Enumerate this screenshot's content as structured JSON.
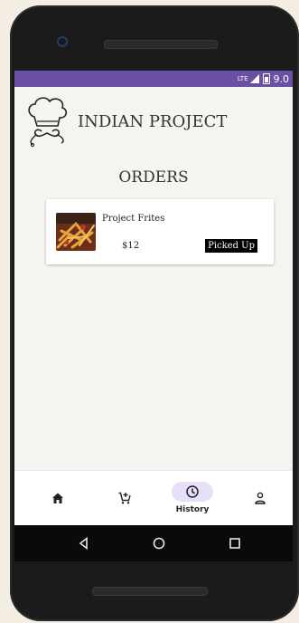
{
  "statusbar": {
    "network": "LTE",
    "time": "9.0"
  },
  "header": {
    "app_title": "INDIAN PROJECT",
    "logo_icon": "chef-hat-icon"
  },
  "main": {
    "title": "ORDERS",
    "orders": [
      {
        "name": "Project Frites",
        "price": "$12",
        "status": "Picked Up",
        "image_icon": "fries-photo"
      }
    ]
  },
  "bottom_nav": {
    "items": [
      {
        "icon": "home-icon",
        "label": ""
      },
      {
        "icon": "cart-add-icon",
        "label": ""
      },
      {
        "icon": "clock-icon",
        "label": "History",
        "selected": true
      },
      {
        "icon": "person-icon",
        "label": ""
      }
    ]
  },
  "colors": {
    "statusbar": "#6a4fa3",
    "nav_active_pill": "#e7defa",
    "badge_bg": "#000000",
    "screen_bg": "#f5f4f1"
  }
}
